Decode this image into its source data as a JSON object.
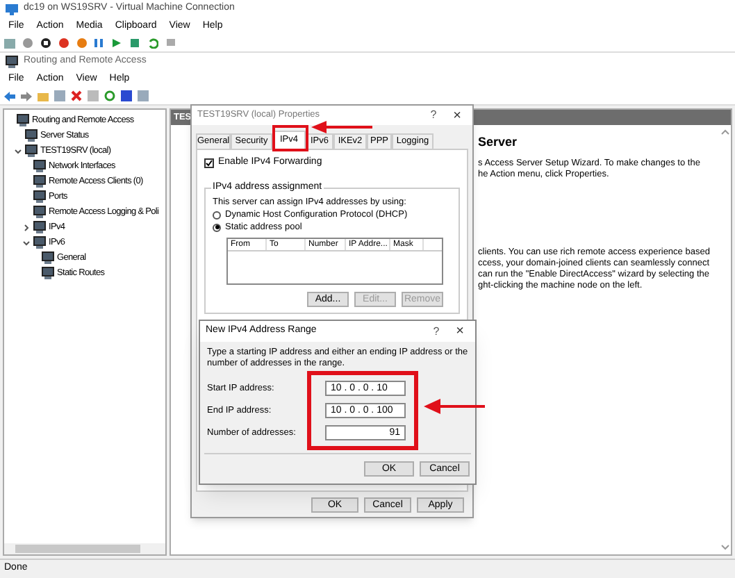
{
  "vm_window": {
    "title": "dc19 on WS19SRV - Virtual Machine Connection",
    "menu": [
      "File",
      "Action",
      "Media",
      "Clipboard",
      "View",
      "Help"
    ]
  },
  "mmc": {
    "title": "Routing and Remote Access",
    "menu": [
      "File",
      "Action",
      "View",
      "Help"
    ],
    "tree": [
      {
        "label": "Routing and Remote Access",
        "children": [
          {
            "label": "Server Status"
          },
          {
            "label": "TEST19SRV (local)",
            "expanded": true,
            "children": [
              {
                "label": "Network Interfaces"
              },
              {
                "label": "Remote Access Clients (0)"
              },
              {
                "label": "Ports"
              },
              {
                "label": "Remote Access Logging & Poli"
              },
              {
                "label": "IPv4",
                "expanded": false
              },
              {
                "label": "IPv6",
                "expanded": true,
                "children": [
                  {
                    "label": "General"
                  },
                  {
                    "label": "Static Routes"
                  }
                ]
              }
            ]
          }
        ]
      }
    ],
    "details": {
      "header": "TES",
      "heading": "Server",
      "paragraphs": [
        [
          "s Access Server Setup Wizard. To make changes to the",
          "he Action menu, click Properties."
        ],
        [
          "clients. You can use rich remote access experience based",
          "ccess, your domain-joined clients can seamlessly connect",
          "can run the \"Enable DirectAccess\" wizard by selecting the",
          "ght-clicking the machine node on the left."
        ]
      ]
    }
  },
  "status_bar": "Done",
  "properties_dialog": {
    "title": "TEST19SRV (local) Properties",
    "help": "?",
    "close": "×",
    "tabs": [
      {
        "label": "General",
        "selected": false
      },
      {
        "label": "Security",
        "selected": false
      },
      {
        "label": "IPv4",
        "selected": true
      },
      {
        "label": "IPv6",
        "selected": false
      },
      {
        "label": "IKEv2",
        "selected": false
      },
      {
        "label": "PPP",
        "selected": false
      },
      {
        "label": "Logging",
        "selected": false
      }
    ],
    "forwarding": {
      "label": "Enable IPv4 Forwarding",
      "checked": true
    },
    "group_title": "IPv4 address assignment",
    "group_text": "This server can assign IPv4 addresses by using:",
    "options": [
      {
        "label": "Dynamic Host Configuration Protocol (DHCP)",
        "selected": false
      },
      {
        "label": "Static address pool",
        "selected": true
      }
    ],
    "columns": [
      "From",
      "To",
      "Number",
      "IP Addre...",
      "Mask"
    ],
    "list_buttons": [
      {
        "label": "Add...",
        "disabled": false
      },
      {
        "label": "Edit...",
        "disabled": true
      },
      {
        "label": "Remove",
        "disabled": true
      }
    ],
    "buttons": [
      "OK",
      "Cancel",
      "Apply"
    ]
  },
  "range_dialog": {
    "title": "New IPv4 Address Range",
    "help": "?",
    "close": "×",
    "text": "Type a starting IP address and either an ending IP address or the number of addresses in the range.",
    "fields": [
      {
        "label": "Start IP address:",
        "value": "10 . 0 . 0 . 10"
      },
      {
        "label": "End IP address:",
        "value": "10 . 0 . 0 . 100"
      },
      {
        "label": "Number of addresses:",
        "value": "91"
      }
    ],
    "buttons": [
      "OK",
      "Cancel"
    ]
  }
}
